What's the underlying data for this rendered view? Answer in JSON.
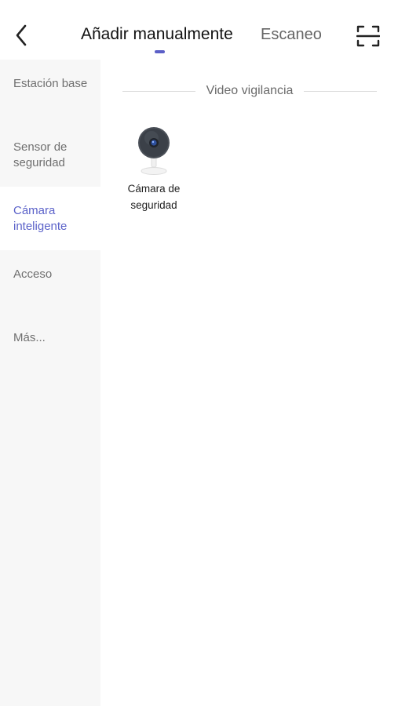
{
  "header": {
    "back_icon": "chevron-left-icon",
    "tab_manual_label": "Añadir manualmente",
    "tab_scan_label": "Escaneo",
    "scan_icon": "scan-frame-icon",
    "accent_color": "#5b5fc7"
  },
  "sidebar": {
    "items": [
      {
        "label": "Estación base",
        "active": false
      },
      {
        "label": "Sensor de seguridad",
        "active": false
      },
      {
        "label": "Cámara inteligente",
        "active": true
      },
      {
        "label": "Acceso",
        "active": false
      },
      {
        "label": "Más...",
        "active": false
      }
    ]
  },
  "main": {
    "section_title": "Video vigilancia",
    "devices": [
      {
        "label": "Cámara de seguridad",
        "icon": "security-camera-icon"
      }
    ]
  }
}
